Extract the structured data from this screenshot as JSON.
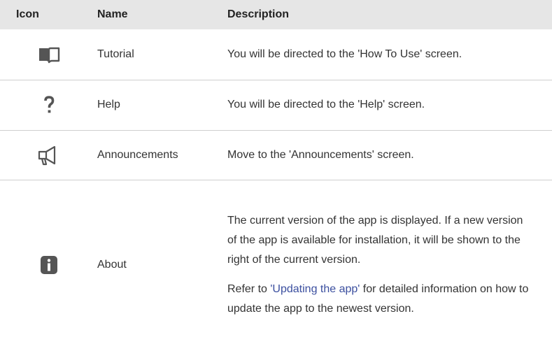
{
  "table": {
    "headers": {
      "icon": "Icon",
      "name": "Name",
      "description": "Description"
    },
    "rows": [
      {
        "icon": "book-icon",
        "name": "Tutorial",
        "description": "You will be directed to the 'How To Use' screen."
      },
      {
        "icon": "question-mark-icon",
        "name": "Help",
        "description": "You will be directed to the 'Help' screen."
      },
      {
        "icon": "megaphone-icon",
        "name": "Announcements",
        "description": "Move to the 'Announcements' screen."
      },
      {
        "icon": "info-icon",
        "name": "About",
        "description": "The current version of the app is displayed. If a new version of the app is available for installation, it will be shown to the right of the current version.",
        "description_2_prefix": "Refer to ",
        "description_2_link": "'Updating the app'",
        "description_2_suffix": " for detailed information on how to update the app to the newest version."
      }
    ]
  },
  "colors": {
    "header_bg": "#e6e6e6",
    "icon_color": "#555555",
    "link_color": "#3b4f9f",
    "divider": "#cfcfcf"
  }
}
